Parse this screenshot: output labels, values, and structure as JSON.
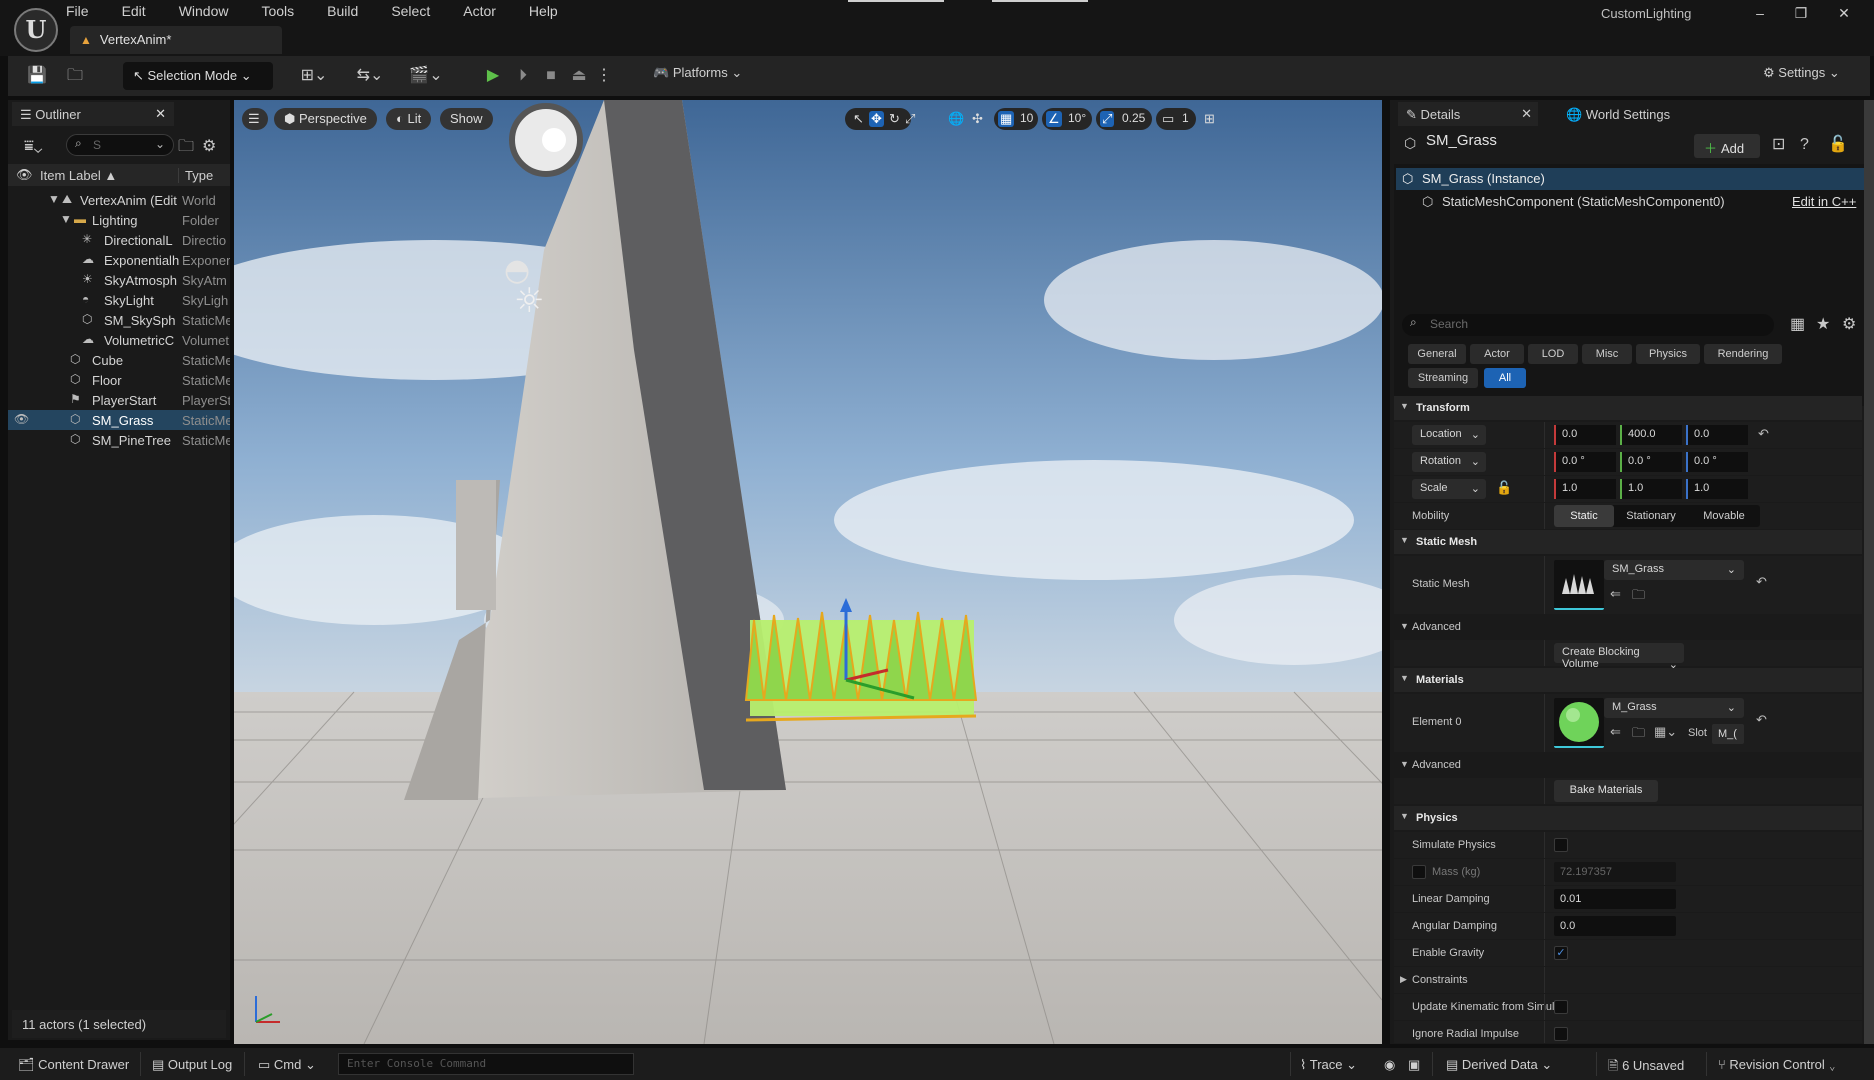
{
  "menu": [
    "File",
    "Edit",
    "Window",
    "Tools",
    "Build",
    "Select",
    "Actor",
    "Help"
  ],
  "document_tab": "VertexAnim*",
  "app_title": "CustomLighting",
  "toolbar": {
    "selection_mode": "Selection Mode",
    "platforms": "Platforms",
    "settings": "Settings"
  },
  "outliner": {
    "tab_label": "Outliner",
    "search_placeholder": "S",
    "col_label": "Item Label",
    "col_type": "Type",
    "rows": [
      {
        "label": "VertexAnim (Edit",
        "type": "World"
      },
      {
        "label": "Lighting",
        "type": "Folder"
      },
      {
        "label": "DirectionalL",
        "type": "Directio"
      },
      {
        "label": "Exponentialh",
        "type": "Exponer"
      },
      {
        "label": "SkyAtmosph",
        "type": "SkyAtm"
      },
      {
        "label": "SkyLight",
        "type": "SkyLigh"
      },
      {
        "label": "SM_SkySph",
        "type": "StaticMe"
      },
      {
        "label": "VolumetricC",
        "type": "Volumet"
      },
      {
        "label": "Cube",
        "type": "StaticMe"
      },
      {
        "label": "Floor",
        "type": "StaticMe"
      },
      {
        "label": "PlayerStart",
        "type": "PlayerSt"
      },
      {
        "label": "SM_Grass",
        "type": "StaticMe"
      },
      {
        "label": "SM_PineTree",
        "type": "StaticMe"
      }
    ],
    "actor_count": "11 actors (1 selected)"
  },
  "viewport": {
    "perspective": "Perspective",
    "lit": "Lit",
    "show": "Show",
    "grid_snap": "10",
    "rot_snap": "10°",
    "scale_snap": "0.25",
    "cam_speed": "1"
  },
  "details": {
    "tab_details": "Details",
    "tab_world_settings": "World Settings",
    "title": "SM_Grass",
    "add": "Add",
    "component_root": "SM_Grass (Instance)",
    "component_child": "StaticMeshComponent (StaticMeshComponent0)",
    "edit_cpp": "Edit in C++",
    "search_placeholder": "Search",
    "categories": [
      "General",
      "Actor",
      "LOD",
      "Misc",
      "Physics",
      "Rendering",
      "Streaming",
      "All"
    ],
    "transform": {
      "section": "Transform",
      "location_label": "Location",
      "location": [
        "0.0",
        "400.0",
        "0.0"
      ],
      "rotation_label": "Rotation",
      "rotation": [
        "0.0 °",
        "0.0 °",
        "0.0 °"
      ],
      "scale_label": "Scale",
      "scale": [
        "1.0",
        "1.0",
        "1.0"
      ],
      "mobility_label": "Mobility",
      "mobility_options": [
        "Static",
        "Stationary",
        "Movable"
      ]
    },
    "static_mesh": {
      "section": "Static Mesh",
      "label": "Static Mesh",
      "value": "SM_Grass",
      "advanced": "Advanced",
      "create_blocking_volume": "Create Blocking Volume"
    },
    "materials": {
      "section": "Materials",
      "element0_label": "Element 0",
      "value": "M_Grass",
      "slot_label": "Slot",
      "slot_value": "M_(",
      "advanced": "Advanced",
      "bake_materials": "Bake Materials"
    },
    "physics": {
      "section": "Physics",
      "simulate_physics": "Simulate Physics",
      "mass_label": "Mass (kg)",
      "mass_value": "72.197357",
      "linear_damping_label": "Linear Damping",
      "linear_damping": "0.01",
      "angular_damping_label": "Angular Damping",
      "angular_damping": "0.0",
      "enable_gravity": "Enable Gravity",
      "constraints": "Constraints",
      "update_kinematic": "Update Kinematic from Simul...",
      "ignore_radial_impulse": "Ignore Radial Impulse"
    }
  },
  "statusbar": {
    "content_drawer": "Content Drawer",
    "output_log": "Output Log",
    "cmd": "Cmd",
    "console_placeholder": "Enter Console Command",
    "trace": "Trace",
    "derived_data": "Derived Data",
    "unsaved": "6 Unsaved",
    "revision_control": "Revision Control"
  },
  "colors": {
    "accent_blue": "#1d63b4",
    "selection": "#24455f",
    "play_green": "#5ec04a",
    "warning_orange": "#e8a33c"
  }
}
